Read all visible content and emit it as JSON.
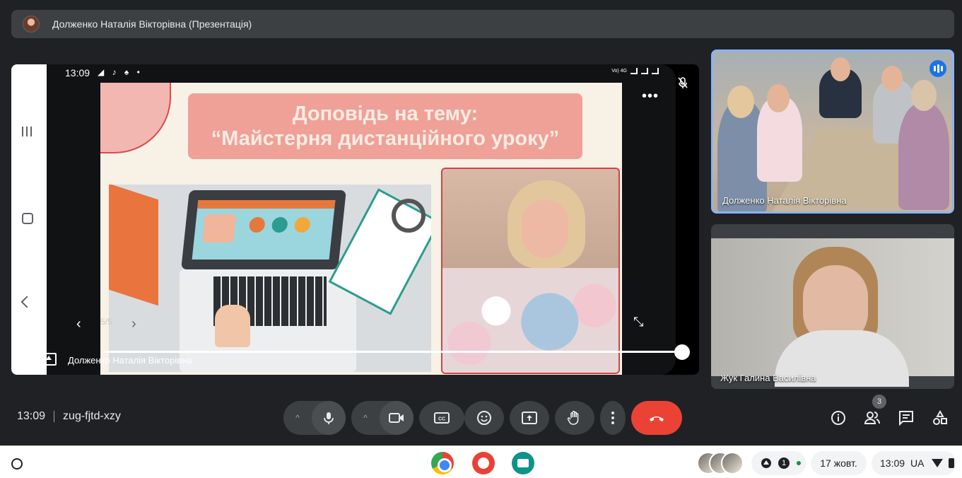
{
  "presenter_bar": {
    "title": "Долженко Наталія Вікторівна (Презентація)"
  },
  "presentation": {
    "phone_status": {
      "time": "13:09",
      "icons": "◢ ♪ ♠ •",
      "network": "Vo) 4G"
    },
    "slide": {
      "title_line1": "Доповідь на тему:",
      "title_line2": "“Майстерня дистанційного уроку”",
      "counter": "5/5"
    },
    "presenter_name": "Долженко Наталія Вікторівна"
  },
  "participants": [
    {
      "name": "Долженко Наталія Вікторівна",
      "speaking": true
    },
    {
      "name": "Жук Галина Василівна",
      "speaking": false
    }
  ],
  "controls": {
    "time": "13:09",
    "meeting_code": "zug-fjtd-xzy",
    "people_count": "3",
    "colors": {
      "end_call": "#ea4335",
      "accent": "#8ab4f8",
      "bar_bg": "#3c4043"
    }
  },
  "shelf": {
    "apps": [
      "chrome-icon",
      "paint-icon",
      "classroom-icon"
    ],
    "notification_count": "1",
    "date": "17 жовт.",
    "time": "13:09",
    "locale": "UA"
  }
}
